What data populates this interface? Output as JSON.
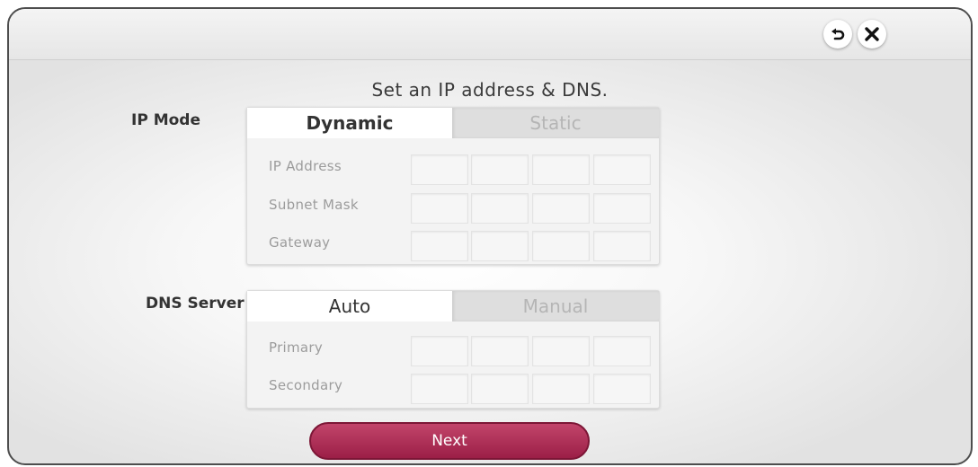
{
  "header": {
    "back_icon": "back-arrow-icon",
    "close_icon": "close-x-icon"
  },
  "title": "Set an IP address & DNS.",
  "ip_mode": {
    "label": "IP Mode",
    "tabs": [
      {
        "label": "Dynamic",
        "selected": true
      },
      {
        "label": "Static",
        "selected": false
      }
    ],
    "fields": [
      {
        "label": "IP Address"
      },
      {
        "label": "Subnet Mask"
      },
      {
        "label": "Gateway"
      }
    ]
  },
  "dns_server": {
    "label": "DNS Server",
    "tabs": [
      {
        "label": "Auto",
        "selected": true
      },
      {
        "label": "Manual",
        "selected": false
      }
    ],
    "fields": [
      {
        "label": "Primary"
      },
      {
        "label": "Secondary"
      }
    ]
  },
  "next_button": {
    "label": "Next"
  },
  "colors": {
    "accent": "#ac2b52",
    "inactive_text": "#b5b5b5"
  }
}
